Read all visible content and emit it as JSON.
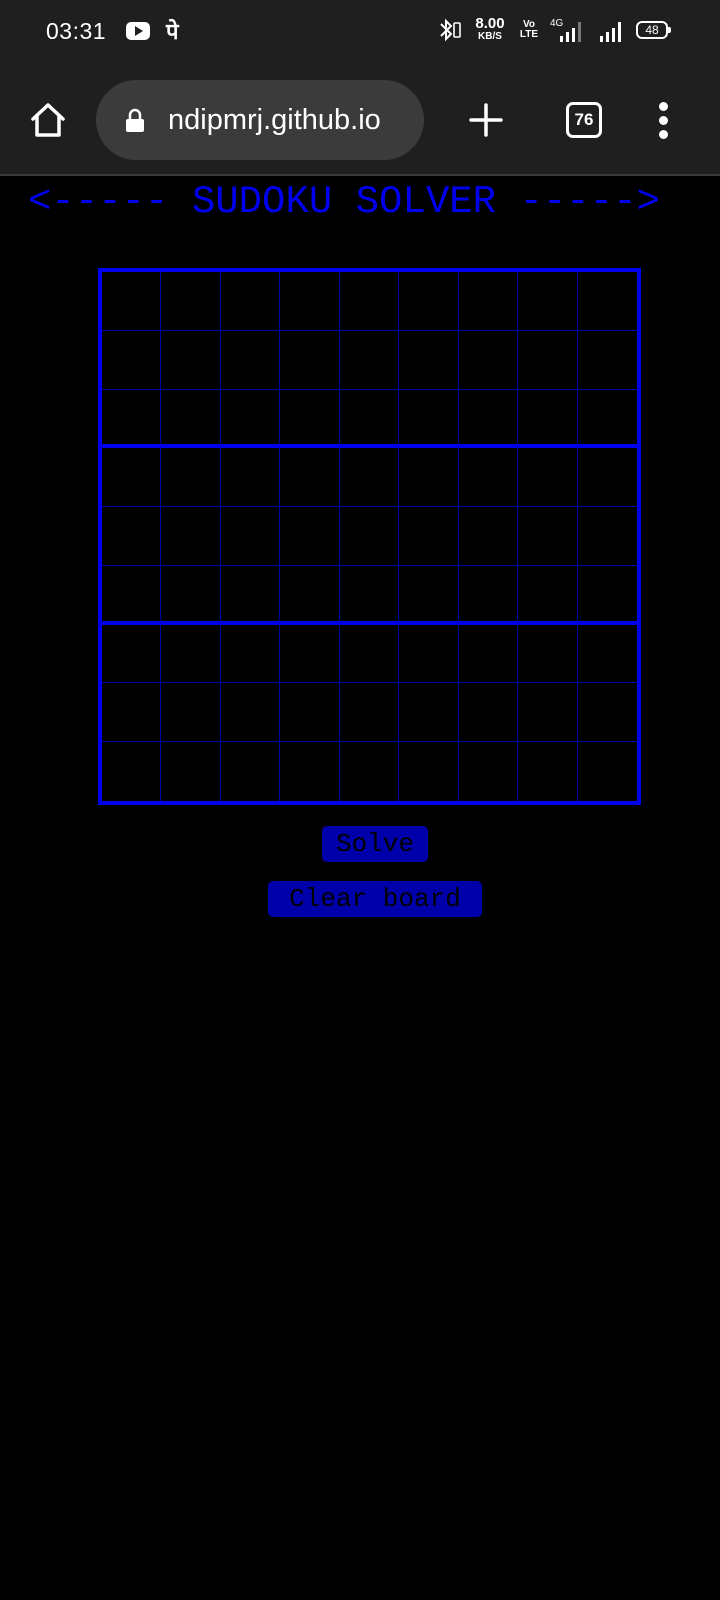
{
  "status_bar": {
    "time": "03:31",
    "app_badge": "पे",
    "net_speed_value": "8.00",
    "net_speed_unit": "KB/S",
    "volte_top": "Vo",
    "volte_bottom": "LTE",
    "signal_tag": "4G",
    "battery": "48"
  },
  "browser": {
    "url": "ndipmrj.github.io",
    "tab_count": "76"
  },
  "page": {
    "title": "<----- SUDOKU SOLVER ----->",
    "solve_label": "Solve",
    "clear_label": "Clear board",
    "accent_color": "#0000ee",
    "button_color": "#0000aa"
  }
}
